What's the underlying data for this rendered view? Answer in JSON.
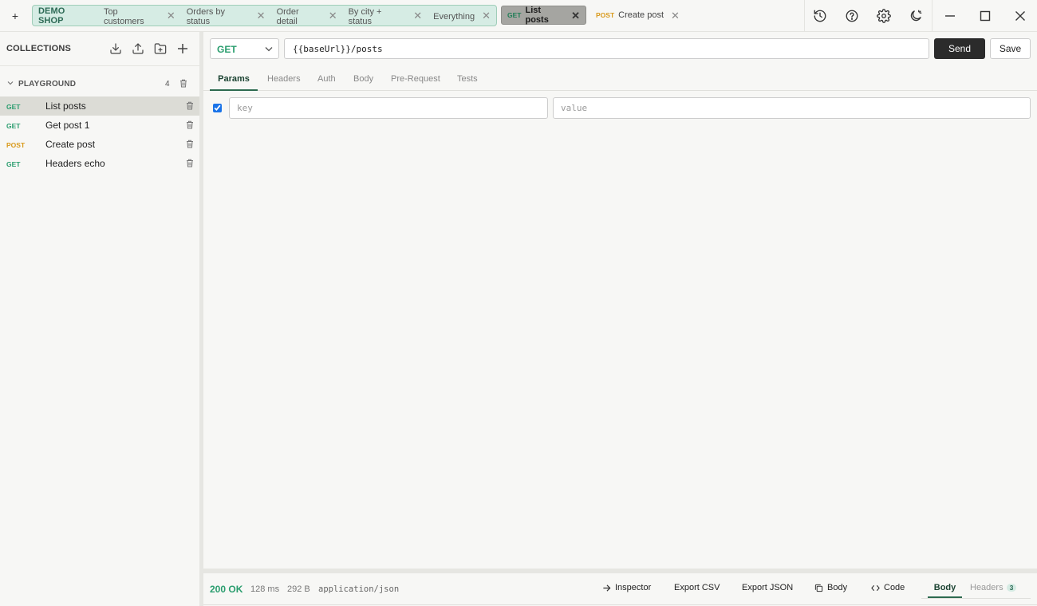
{
  "titlebar": {
    "new_tab_label": "+",
    "group": {
      "label": "DEMO SHOP",
      "color": "#d6ece4",
      "tabs": [
        {
          "label": "Top customers"
        },
        {
          "label": "Orders by status"
        },
        {
          "label": "Order detail"
        },
        {
          "label": "By city + status"
        },
        {
          "label": "Everything"
        }
      ]
    },
    "request_tabs": [
      {
        "method": "GET",
        "label": "List posts",
        "active": true
      },
      {
        "method": "POST",
        "label": "Create post",
        "active": false
      }
    ],
    "close_glyph": "✕",
    "tool_icons": [
      "history-icon",
      "help-icon",
      "settings-icon",
      "theme-toggle-icon"
    ],
    "window_icons": [
      "minimize-icon",
      "maximize-icon",
      "close-icon"
    ]
  },
  "sidebar": {
    "title": "COLLECTIONS",
    "header_icons": [
      "import-icon",
      "export-icon",
      "new-folder-icon",
      "add-icon"
    ],
    "folder": {
      "name": "PLAYGROUND",
      "count": "4",
      "expanded": true
    },
    "requests": [
      {
        "method": "GET",
        "name": "List posts",
        "selected": true
      },
      {
        "method": "GET",
        "name": "Get post 1",
        "selected": false
      },
      {
        "method": "POST",
        "name": "Create post",
        "selected": false
      },
      {
        "method": "GET",
        "name": "Headers echo",
        "selected": false
      }
    ]
  },
  "request": {
    "method": "GET",
    "url": "{{baseUrl}}/posts",
    "send_label": "Send",
    "save_label": "Save",
    "tabs": [
      "Params",
      "Headers",
      "Auth",
      "Body",
      "Pre-Request",
      "Tests"
    ],
    "active_tab": "Params",
    "params": [
      {
        "enabled": true,
        "key_placeholder": "key",
        "value_placeholder": "value"
      }
    ]
  },
  "response": {
    "status": "200 OK",
    "time": "128 ms",
    "size": "292 B",
    "content_type": "application/json",
    "actions": [
      "Inspector",
      "Export CSV",
      "Export JSON",
      "Body",
      "Code"
    ],
    "action_icons": [
      "arrow-right-icon",
      "",
      "",
      "copy-icon",
      "code-icon"
    ],
    "tabs": [
      {
        "label": "Body",
        "active": true
      },
      {
        "label": "Headers",
        "count": "3",
        "active": false
      }
    ]
  },
  "colors": {
    "get": "#2a9d6e",
    "post": "#d99a1c",
    "accent": "#2d6a4f",
    "send": "#2b2b2b"
  }
}
